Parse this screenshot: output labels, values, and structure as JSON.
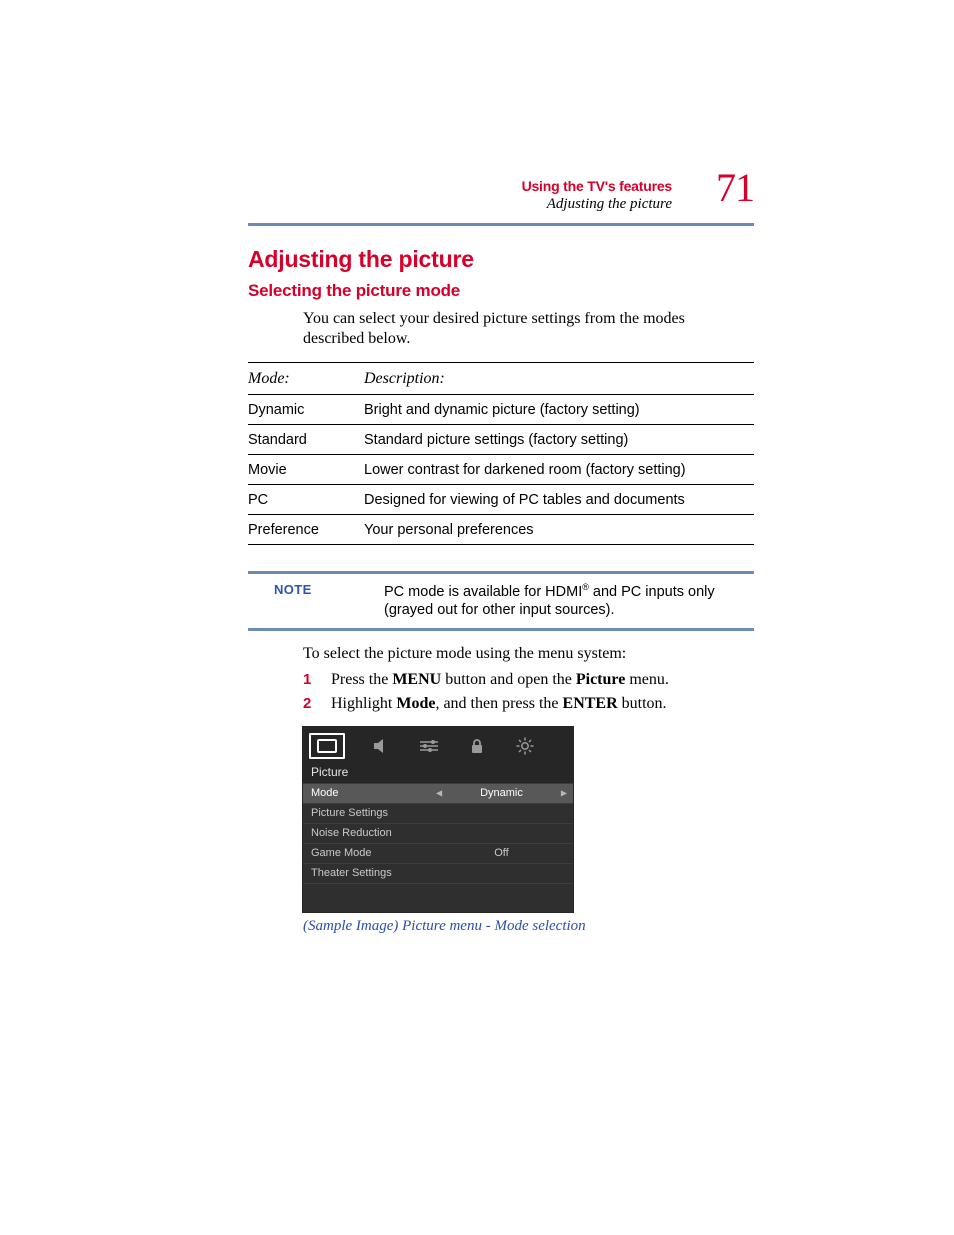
{
  "header": {
    "chapter": "Using the TV's features",
    "subtitle": "Adjusting the picture",
    "page_number": "71"
  },
  "section_title": "Adjusting the picture",
  "subsection_title": "Selecting the picture mode",
  "intro_text": "You can select your desired picture settings from the modes described below.",
  "table": {
    "headers": {
      "mode": "Mode:",
      "description": "Description:"
    },
    "rows": [
      {
        "mode": "Dynamic",
        "description": "Bright and dynamic picture (factory setting)"
      },
      {
        "mode": "Standard",
        "description": "Standard picture settings (factory setting)"
      },
      {
        "mode": "Movie",
        "description": "Lower contrast for darkened room (factory setting)"
      },
      {
        "mode": "PC",
        "description": "Designed for viewing of PC tables and documents"
      },
      {
        "mode": "Preference",
        "description": "Your personal preferences"
      }
    ]
  },
  "note": {
    "label": "NOTE",
    "text_before": "PC mode is available for HDMI",
    "text_after": " and PC inputs only (grayed out for other input sources)."
  },
  "steps_intro": "To select the picture mode using the menu system:",
  "steps": [
    {
      "num": "1",
      "t1": "Press the ",
      "b1": "MENU",
      "t2": " button and open the ",
      "b2": "Picture",
      "t3": " menu."
    },
    {
      "num": "2",
      "t1": "Highlight ",
      "b1": "Mode",
      "t2": ", and then press the ",
      "b2": "ENTER",
      "t3": " button."
    }
  ],
  "tv_menu": {
    "section": "Picture",
    "rows": [
      {
        "label": "Mode",
        "value": "Dynamic",
        "selected": true,
        "arrows": true
      },
      {
        "label": "Picture Settings",
        "value": "",
        "selected": false,
        "arrows": false
      },
      {
        "label": "Noise Reduction",
        "value": "",
        "selected": false,
        "arrows": false
      },
      {
        "label": "Game Mode",
        "value": "Off",
        "selected": false,
        "arrows": false
      },
      {
        "label": "Theater Settings",
        "value": "",
        "selected": false,
        "arrows": false
      }
    ]
  },
  "caption": "(Sample Image) Picture menu - Mode selection"
}
